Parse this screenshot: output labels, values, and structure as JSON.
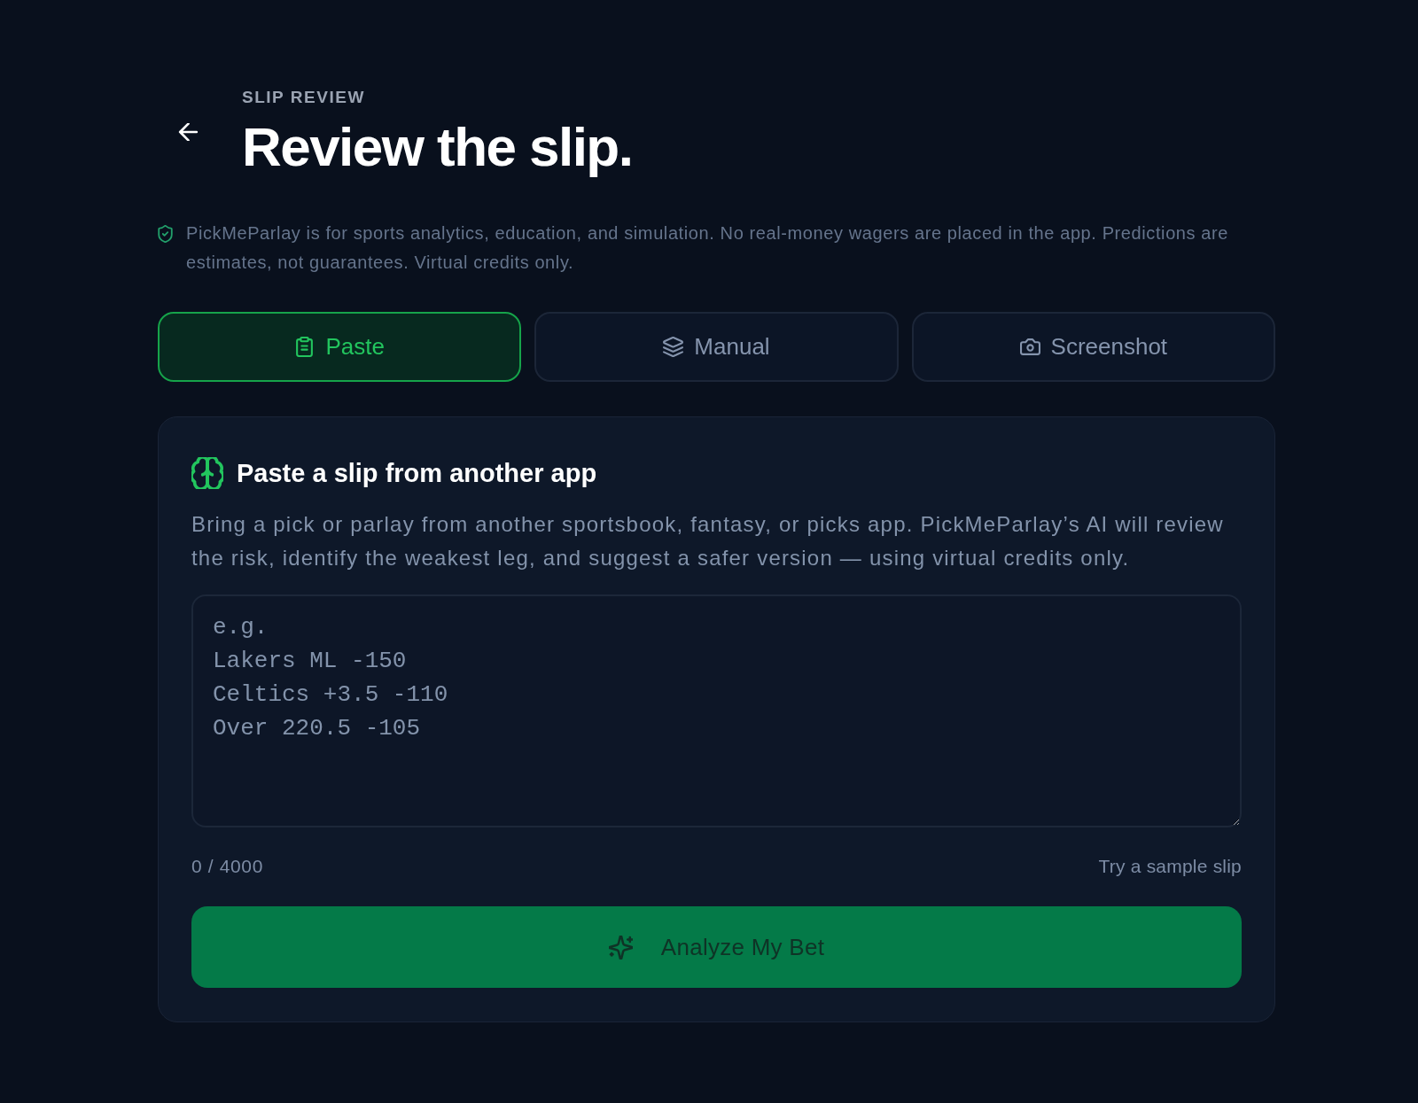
{
  "header": {
    "eyebrow": "SLIP REVIEW",
    "title": "Review the slip."
  },
  "disclaimer": "PickMeParlay is for sports analytics, education, and simulation. No real-money wagers are placed in the app. Predictions are estimates, not guarantees. Virtual credits only.",
  "tabs": [
    {
      "label": "Paste",
      "selected": true
    },
    {
      "label": "Manual",
      "selected": false
    },
    {
      "label": "Screenshot",
      "selected": false
    }
  ],
  "panel": {
    "title": "Paste a slip from another app",
    "description": "Bring a pick or parlay from another sportsbook, fantasy, or picks app. PickMeParlay’s AI will review the risk, identify the weakest leg, and suggest a safer version — using virtual credits only.",
    "slip_input": {
      "placeholder": "e.g.\nLakers ML -150\nCeltics +3.5 -110\nOver 220.5 -105"
    },
    "char_count": "0 / 4000",
    "sample_link": "Try a sample slip",
    "submit_button": "Analyze My Bet"
  }
}
